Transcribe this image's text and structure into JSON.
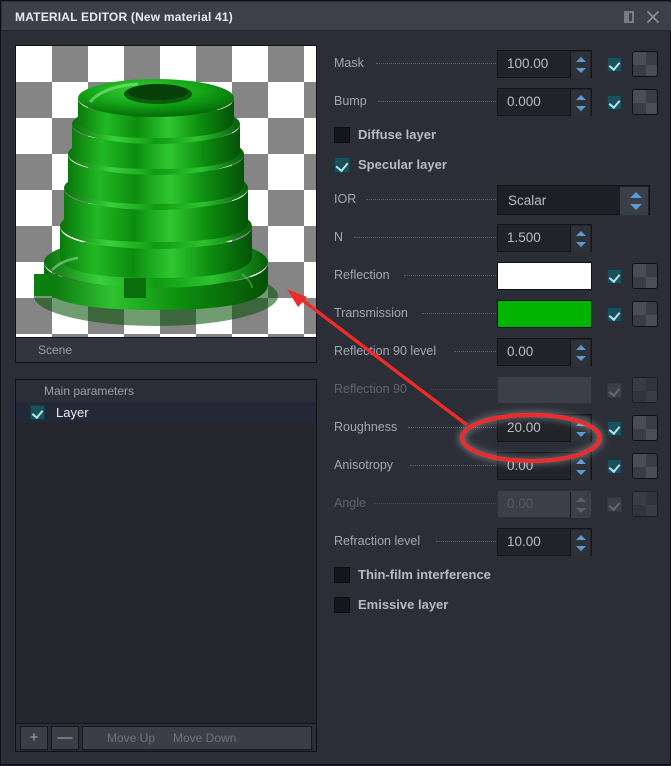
{
  "window": {
    "title": "MATERIAL EDITOR (New material 41)",
    "restore_icon": "restore-icon",
    "close_icon": "close-icon"
  },
  "preview": {
    "caption": "Scene",
    "object_color": "#17a017",
    "background": "checkerboard"
  },
  "layers_panel": {
    "header": "Main parameters",
    "items": [
      {
        "label": "Layer",
        "checked": true,
        "selected": true
      }
    ],
    "toolbar": {
      "add_label": "+",
      "remove_label": "—",
      "move_up_label": "Move Up",
      "move_down_label": "Move Down"
    }
  },
  "properties": {
    "rows": [
      {
        "label": "Mask",
        "value": "100.00",
        "kind": "spin",
        "checkbox": "on",
        "texture": true,
        "disabled": false
      },
      {
        "label": "Bump",
        "value": "0.000",
        "kind": "spin",
        "checkbox": "on",
        "texture": true,
        "disabled": false
      },
      {
        "label": "Diffuse layer",
        "kind": "toggle",
        "checked": false
      },
      {
        "label": "Specular layer",
        "kind": "toggle",
        "checked": true
      },
      {
        "label": "IOR",
        "value": "Scalar",
        "kind": "combo",
        "checkbox": "none",
        "texture": false,
        "disabled": false
      },
      {
        "label": "N",
        "value": "1.500",
        "kind": "spin",
        "checkbox": "none",
        "texture": false,
        "disabled": false
      },
      {
        "label": "Reflection",
        "value": "",
        "kind": "color",
        "color": "#ffffff",
        "checkbox": "on",
        "texture": true,
        "disabled": false
      },
      {
        "label": "Transmission",
        "value": "",
        "kind": "color",
        "color": "#00b400",
        "checkbox": "on",
        "texture": true,
        "disabled": false
      },
      {
        "label": "Reflection 90 level",
        "value": "0.00",
        "kind": "spin",
        "checkbox": "none",
        "texture": false,
        "disabled": false
      },
      {
        "label": "Reflection 90",
        "value": "",
        "kind": "plain",
        "checkbox": "off-dim",
        "texture": true,
        "disabled": true
      },
      {
        "label": "Roughness",
        "value": "20.00",
        "kind": "spin",
        "checkbox": "on",
        "texture": true,
        "disabled": false,
        "highlighted": true
      },
      {
        "label": "Anisotropy",
        "value": "0.00",
        "kind": "spin",
        "checkbox": "on",
        "texture": true,
        "disabled": false
      },
      {
        "label": "Angle",
        "value": "0.00",
        "kind": "spin",
        "checkbox": "off-dim",
        "texture": true,
        "disabled": true
      },
      {
        "label": "Refraction level",
        "value": "10.00",
        "kind": "spin",
        "checkbox": "none",
        "texture": false,
        "disabled": false
      },
      {
        "label": "Thin-film interference",
        "kind": "toggle",
        "checked": false
      },
      {
        "label": "Emissive layer",
        "kind": "toggle",
        "checked": false
      }
    ]
  },
  "annotation": {
    "highlight_color": "#ee2b2b",
    "ellipse_target": "Roughness value field",
    "arrow_from": "roughness-field",
    "arrow_to": "preview-render"
  }
}
